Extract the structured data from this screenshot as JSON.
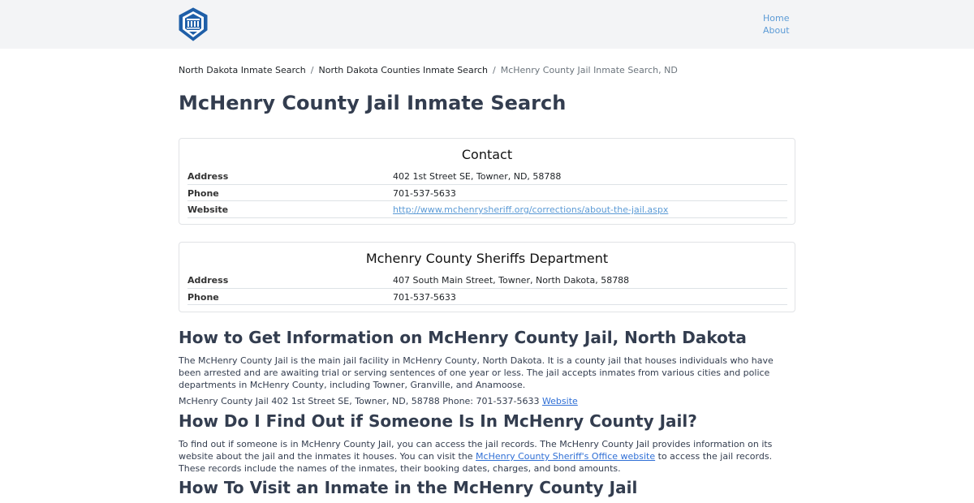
{
  "nav": {
    "logo_icon": "sheriff-badge-icon",
    "home": "Home",
    "about": "About"
  },
  "breadcrumb": {
    "item1": "North Dakota Inmate Search",
    "item2": "North Dakota Counties Inmate Search",
    "item3": "McHenry County Jail Inmate Search, ND",
    "separator": "/"
  },
  "page_title": "McHenry County Jail Inmate Search",
  "contact_card": {
    "title": "Contact",
    "address_label": "Address",
    "address_value": "402 1st Street SE, Towner, ND, 58788",
    "phone_label": "Phone",
    "phone_value": "701-537-5633",
    "website_label": "Website",
    "website_value": "http://www.mchenrysheriff.org/corrections/about-the-jail.aspx"
  },
  "sheriff_card": {
    "title": "Mchenry County Sheriffs Department",
    "address_label": "Address",
    "address_value": "407 South Main Street, Towner, North Dakota, 58788",
    "phone_label": "Phone",
    "phone_value": "701-537-5633"
  },
  "section1": {
    "heading": "How to Get Information on McHenry County Jail, North Dakota",
    "para": "The McHenry County Jail is the main jail facility in McHenry County, North Dakota. It is a county jail that houses individuals who have been arrested and are awaiting trial or serving sentences of one year or less. The jail accepts inmates from various cities and police departments in McHenry County, including Towner, Granville, and Anamoose.",
    "info_line": "McHenry County Jail 402 1st Street SE, Towner, ND, 58788 Phone: 701-537-5633",
    "info_link": "Website"
  },
  "section2": {
    "heading": "How Do I Find Out if Someone Is In McHenry County Jail?",
    "para_before": "To find out if someone is in McHenry County Jail, you can access the jail records. The McHenry County Jail provides information on its website about the jail and the inmates it houses. You can visit the",
    "link": "McHenry County Sheriff's Office website",
    "para_after": "to access the jail records. These records include the names of the inmates, their booking dates, charges, and bond amounts."
  },
  "section3": {
    "heading": "How To Visit an Inmate in the McHenry County Jail"
  }
}
